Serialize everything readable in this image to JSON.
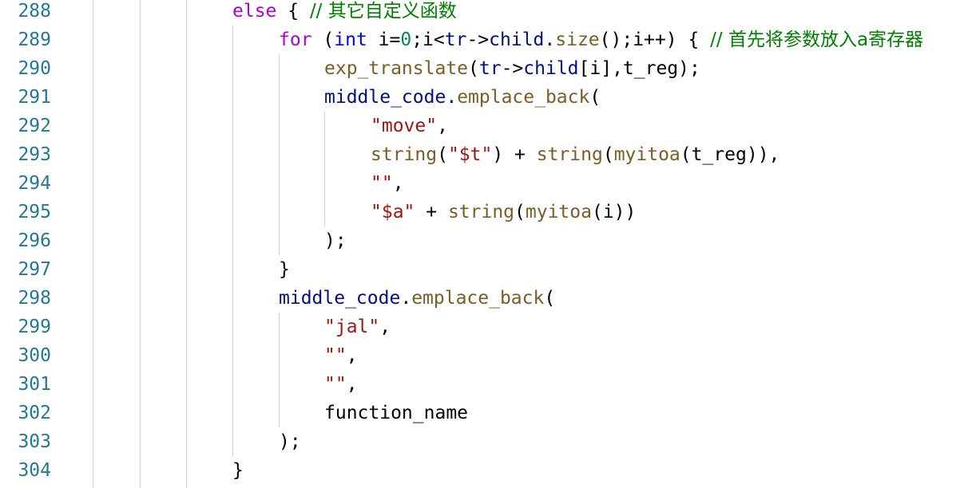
{
  "theme": {
    "background": "#ffffff",
    "line_number": "#237893",
    "keyword": "#af00db",
    "type_keyword": "#0000ff",
    "identifier": "#001080",
    "function": "#795e26",
    "string": "#a31515",
    "number": "#098658",
    "comment": "#008000",
    "plain": "#000000",
    "indent_guide": "#d3d3d3"
  },
  "lines": [
    {
      "number": "288",
      "indent": 4,
      "tokens": [
        {
          "t": "else",
          "k": "keyword"
        },
        {
          "t": " { ",
          "k": "plain"
        },
        {
          "t": "// 其它自定义函数",
          "k": "comment"
        }
      ]
    },
    {
      "number": "289",
      "indent": 5,
      "tokens": [
        {
          "t": "for",
          "k": "keyword"
        },
        {
          "t": " (",
          "k": "plain"
        },
        {
          "t": "int",
          "k": "type_keyword"
        },
        {
          "t": " i=",
          "k": "plain"
        },
        {
          "t": "0",
          "k": "number"
        },
        {
          "t": ";i<",
          "k": "plain"
        },
        {
          "t": "tr",
          "k": "identifier"
        },
        {
          "t": "->",
          "k": "plain"
        },
        {
          "t": "child",
          "k": "identifier"
        },
        {
          "t": ".",
          "k": "plain"
        },
        {
          "t": "size",
          "k": "function"
        },
        {
          "t": "();i++) { ",
          "k": "plain"
        },
        {
          "t": "// 首先将参数放入a寄存器",
          "k": "comment"
        }
      ]
    },
    {
      "number": "290",
      "indent": 6,
      "tokens": [
        {
          "t": "exp_translate",
          "k": "function"
        },
        {
          "t": "(",
          "k": "plain"
        },
        {
          "t": "tr",
          "k": "identifier"
        },
        {
          "t": "->",
          "k": "plain"
        },
        {
          "t": "child",
          "k": "identifier"
        },
        {
          "t": "[i],t_reg);",
          "k": "plain"
        }
      ]
    },
    {
      "number": "291",
      "indent": 6,
      "tokens": [
        {
          "t": "middle_code",
          "k": "identifier"
        },
        {
          "t": ".",
          "k": "plain"
        },
        {
          "t": "emplace_back",
          "k": "function"
        },
        {
          "t": "(",
          "k": "plain"
        }
      ]
    },
    {
      "number": "292",
      "indent": 7,
      "tokens": [
        {
          "t": "\"move\"",
          "k": "string"
        },
        {
          "t": ",",
          "k": "plain"
        }
      ]
    },
    {
      "number": "293",
      "indent": 7,
      "tokens": [
        {
          "t": "string",
          "k": "function"
        },
        {
          "t": "(",
          "k": "plain"
        },
        {
          "t": "\"$t\"",
          "k": "string"
        },
        {
          "t": ") + ",
          "k": "plain"
        },
        {
          "t": "string",
          "k": "function"
        },
        {
          "t": "(",
          "k": "plain"
        },
        {
          "t": "myitoa",
          "k": "function"
        },
        {
          "t": "(t_reg)),",
          "k": "plain"
        }
      ]
    },
    {
      "number": "294",
      "indent": 7,
      "tokens": [
        {
          "t": "\"\"",
          "k": "string"
        },
        {
          "t": ",",
          "k": "plain"
        }
      ]
    },
    {
      "number": "295",
      "indent": 7,
      "tokens": [
        {
          "t": "\"$a\"",
          "k": "string"
        },
        {
          "t": " + ",
          "k": "plain"
        },
        {
          "t": "string",
          "k": "function"
        },
        {
          "t": "(",
          "k": "plain"
        },
        {
          "t": "myitoa",
          "k": "function"
        },
        {
          "t": "(i))",
          "k": "plain"
        }
      ]
    },
    {
      "number": "296",
      "indent": 6,
      "tokens": [
        {
          "t": ");",
          "k": "plain"
        }
      ]
    },
    {
      "number": "297",
      "indent": 5,
      "tokens": [
        {
          "t": "}",
          "k": "plain"
        }
      ]
    },
    {
      "number": "298",
      "indent": 5,
      "tokens": [
        {
          "t": "middle_code",
          "k": "identifier"
        },
        {
          "t": ".",
          "k": "plain"
        },
        {
          "t": "emplace_back",
          "k": "function"
        },
        {
          "t": "(",
          "k": "plain"
        }
      ]
    },
    {
      "number": "299",
      "indent": 6,
      "tokens": [
        {
          "t": "\"jal\"",
          "k": "string"
        },
        {
          "t": ",",
          "k": "plain"
        }
      ]
    },
    {
      "number": "300",
      "indent": 6,
      "tokens": [
        {
          "t": "\"\"",
          "k": "string"
        },
        {
          "t": ",",
          "k": "plain"
        }
      ]
    },
    {
      "number": "301",
      "indent": 6,
      "tokens": [
        {
          "t": "\"\"",
          "k": "string"
        },
        {
          "t": ",",
          "k": "plain"
        }
      ]
    },
    {
      "number": "302",
      "indent": 6,
      "tokens": [
        {
          "t": "function_name",
          "k": "plain"
        }
      ]
    },
    {
      "number": "303",
      "indent": 5,
      "tokens": [
        {
          "t": ");",
          "k": "plain"
        }
      ]
    },
    {
      "number": "304",
      "indent": 4,
      "tokens": [
        {
          "t": "}",
          "k": "plain"
        }
      ]
    }
  ]
}
